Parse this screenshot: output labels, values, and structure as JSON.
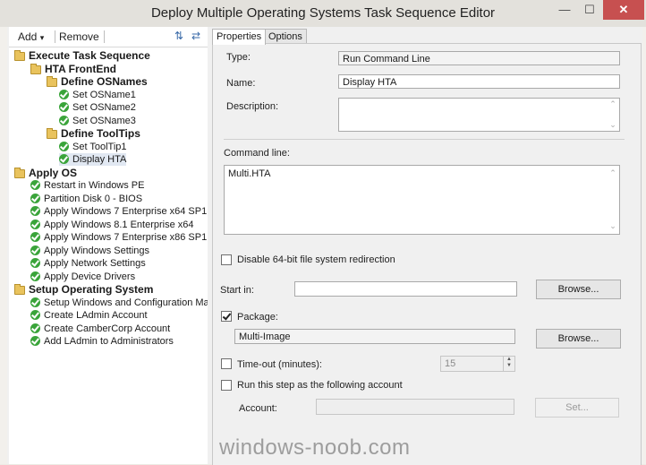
{
  "window": {
    "title": "Deploy Multiple Operating Systems Task Sequence Editor"
  },
  "toolbar": {
    "add_label": "Add",
    "add_arrow": "▾",
    "remove_label": "Remove"
  },
  "tree": {
    "items": [
      {
        "label": "Execute Task Sequence",
        "type": "group"
      },
      {
        "label": "HTA FrontEnd",
        "type": "group"
      },
      {
        "label": "Define OSNames",
        "type": "group"
      },
      {
        "label": "Set OSName1",
        "type": "step"
      },
      {
        "label": "Set OSName2",
        "type": "step"
      },
      {
        "label": "Set OSName3",
        "type": "step"
      },
      {
        "label": "Define ToolTips",
        "type": "group"
      },
      {
        "label": "Set ToolTip1",
        "type": "step"
      },
      {
        "label": "Display HTA",
        "type": "step",
        "selected": true
      },
      {
        "label": "Apply OS",
        "type": "group"
      },
      {
        "label": "Restart in Windows PE",
        "type": "step"
      },
      {
        "label": "Partition Disk 0 - BIOS",
        "type": "step"
      },
      {
        "label": "Apply Windows 7 Enterprise x64 SP1",
        "type": "step"
      },
      {
        "label": "Apply Windows 8.1 Enterprise x64",
        "type": "step"
      },
      {
        "label": "Apply Windows 7 Enterprise x86 SP1",
        "type": "step"
      },
      {
        "label": "Apply Windows Settings",
        "type": "step"
      },
      {
        "label": "Apply Network Settings",
        "type": "step"
      },
      {
        "label": "Apply Device Drivers",
        "type": "step"
      },
      {
        "label": "Setup Operating System",
        "type": "group"
      },
      {
        "label": "Setup Windows and Configuration Ma",
        "type": "step"
      },
      {
        "label": "Create LAdmin Account",
        "type": "step"
      },
      {
        "label": "Create CamberCorp Account",
        "type": "step"
      },
      {
        "label": "Add LAdmin to Administrators",
        "type": "step"
      }
    ]
  },
  "tabs": {
    "properties": "Properties",
    "options": "Options"
  },
  "props": {
    "type_label": "Type:",
    "type_value": "Run Command Line",
    "name_label": "Name:",
    "name_value": "Display HTA",
    "description_label": "Description:",
    "description_value": "",
    "command_line_label": "Command line:",
    "command_line_value": "Multi.HTA",
    "disable_redirect_label": "Disable 64-bit file system redirection",
    "disable_redirect_checked": false,
    "start_in_label": "Start in:",
    "start_in_value": "",
    "browse_label": "Browse...",
    "package_label": "Package:",
    "package_checked": true,
    "package_value": "Multi-Image",
    "timeout_label": "Time-out (minutes):",
    "timeout_checked": false,
    "timeout_value": "15",
    "run_as_label": "Run this step as the following account",
    "run_as_checked": false,
    "account_label": "Account:",
    "account_value": "",
    "set_label": "Set..."
  },
  "watermark": {
    "text": "windows-noob.com"
  },
  "colors": {
    "close": "#c75050",
    "check": "#3aa43a",
    "folder": "#e9c35d"
  },
  "icons": [
    "minimize-icon",
    "maximize-icon",
    "close-icon",
    "move-up-icon",
    "move-down-icon",
    "folder-icon",
    "check-icon",
    "spin-up-icon",
    "spin-down-icon"
  ]
}
